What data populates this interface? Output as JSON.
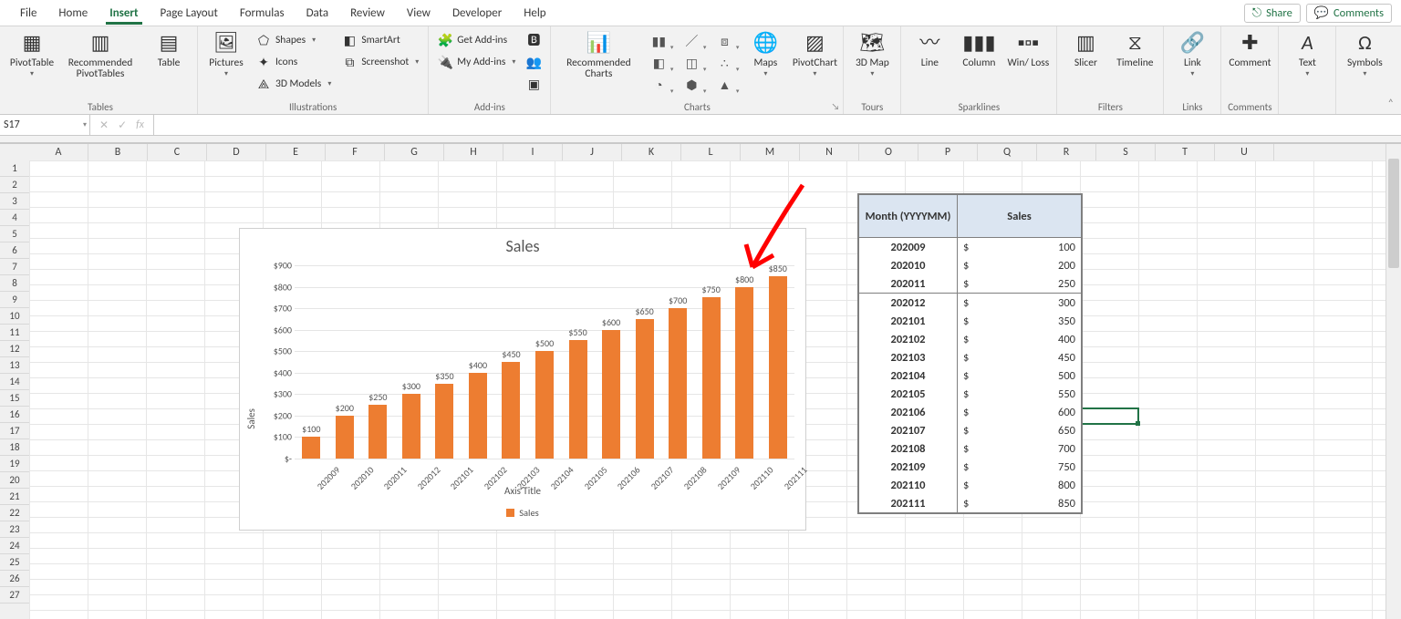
{
  "tabs": [
    "File",
    "Home",
    "Insert",
    "Page Layout",
    "Formulas",
    "Data",
    "Review",
    "View",
    "Developer",
    "Help"
  ],
  "active_tab": "Insert",
  "top_right": {
    "share": "Share",
    "comments": "Comments"
  },
  "ribbon": {
    "tables": {
      "label": "Tables",
      "pivot": "PivotTable",
      "recpivot": "Recommended PivotTables",
      "table": "Table"
    },
    "illustrations": {
      "label": "Illustrations",
      "pictures": "Pictures",
      "shapes": "Shapes",
      "icons": "Icons",
      "models": "3D Models",
      "smartart": "SmartArt",
      "screenshot": "Screenshot"
    },
    "addins": {
      "label": "Add-ins",
      "get": "Get Add-ins",
      "my": "My Add-ins"
    },
    "charts": {
      "label": "Charts",
      "rec": "Recommended Charts",
      "maps": "Maps",
      "pivotchart": "PivotChart"
    },
    "tours": {
      "label": "Tours",
      "map": "3D Map"
    },
    "sparklines": {
      "label": "Sparklines",
      "line": "Line",
      "col": "Column",
      "wl": "Win/ Loss"
    },
    "filters": {
      "label": "Filters",
      "slicer": "Slicer",
      "timeline": "Timeline"
    },
    "links": {
      "label": "Links",
      "link": "Link"
    },
    "comments": {
      "label": "Comments",
      "comment": "Comment"
    },
    "text": {
      "label": "",
      "text": "Text"
    },
    "symbols": {
      "label": "",
      "symbols": "Symbols",
      "omega": "Ω"
    }
  },
  "namebox": "S17",
  "fx": "fx",
  "columns": [
    "A",
    "B",
    "C",
    "D",
    "E",
    "F",
    "G",
    "H",
    "I",
    "J",
    "K",
    "L",
    "M",
    "N",
    "O",
    "P",
    "Q",
    "R",
    "S",
    "T",
    "U"
  ],
  "row_count": 27,
  "active_cell": {
    "col": "S",
    "row": 17
  },
  "data_table": {
    "h1": "Month (YYYYMM)",
    "h2": "Sales",
    "sym": "$",
    "rows": [
      {
        "m": "202009",
        "v": "100"
      },
      {
        "m": "202010",
        "v": "200"
      },
      {
        "m": "202011",
        "v": "250",
        "sep": true
      },
      {
        "m": "202012",
        "v": "300"
      },
      {
        "m": "202101",
        "v": "350"
      },
      {
        "m": "202102",
        "v": "400"
      },
      {
        "m": "202103",
        "v": "450"
      },
      {
        "m": "202104",
        "v": "500"
      },
      {
        "m": "202105",
        "v": "550"
      },
      {
        "m": "202106",
        "v": "600"
      },
      {
        "m": "202107",
        "v": "650"
      },
      {
        "m": "202108",
        "v": "700"
      },
      {
        "m": "202109",
        "v": "750"
      },
      {
        "m": "202110",
        "v": "800"
      },
      {
        "m": "202111",
        "v": "850"
      }
    ]
  },
  "chart_data": {
    "type": "bar",
    "title": "Sales",
    "ylabel": "Sales",
    "xlabel": "Axis Title",
    "legend": "Sales",
    "ylim": [
      0,
      900
    ],
    "ystep": 100,
    "y_tick_prefix": "$",
    "y_tick_zero": "$-",
    "categories": [
      "202009",
      "202010",
      "202011",
      "202012",
      "202101",
      "202102",
      "202103",
      "202104",
      "202105",
      "202106",
      "202107",
      "202108",
      "202109",
      "202110",
      "202111"
    ],
    "values": [
      100,
      200,
      250,
      300,
      350,
      400,
      450,
      500,
      550,
      600,
      650,
      700,
      750,
      800,
      850
    ],
    "labels": [
      "$100",
      "$200",
      "$250",
      "$300",
      "$350",
      "$400",
      "$450",
      "$500",
      "$550",
      "$600",
      "$650",
      "$700",
      "$750",
      "$800",
      "$850"
    ]
  }
}
